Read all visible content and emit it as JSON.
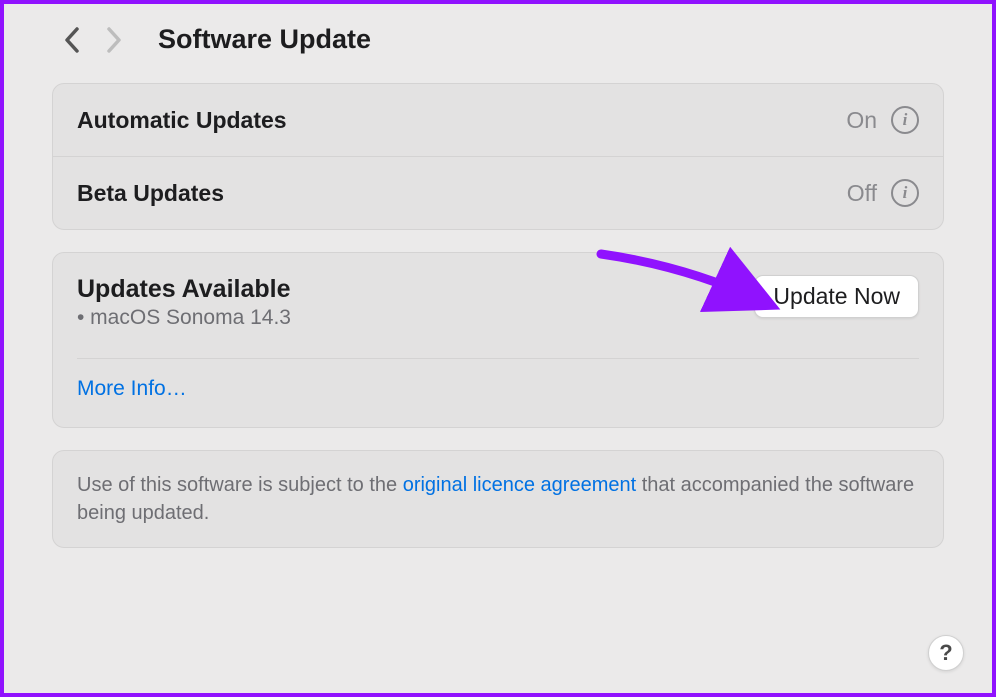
{
  "header": {
    "title": "Software Update"
  },
  "settings": {
    "automatic_updates": {
      "label": "Automatic Updates",
      "value": "On"
    },
    "beta_updates": {
      "label": "Beta Updates",
      "value": "Off"
    }
  },
  "updates": {
    "title": "Updates Available",
    "button_label": "Update Now",
    "item": "• macOS Sonoma 14.3",
    "more_info": "More Info…"
  },
  "footer": {
    "text_before": "Use of this software is subject to the ",
    "link": "original licence agreement",
    "text_after": " that accompanied the software being updated."
  },
  "help": {
    "label": "?"
  }
}
